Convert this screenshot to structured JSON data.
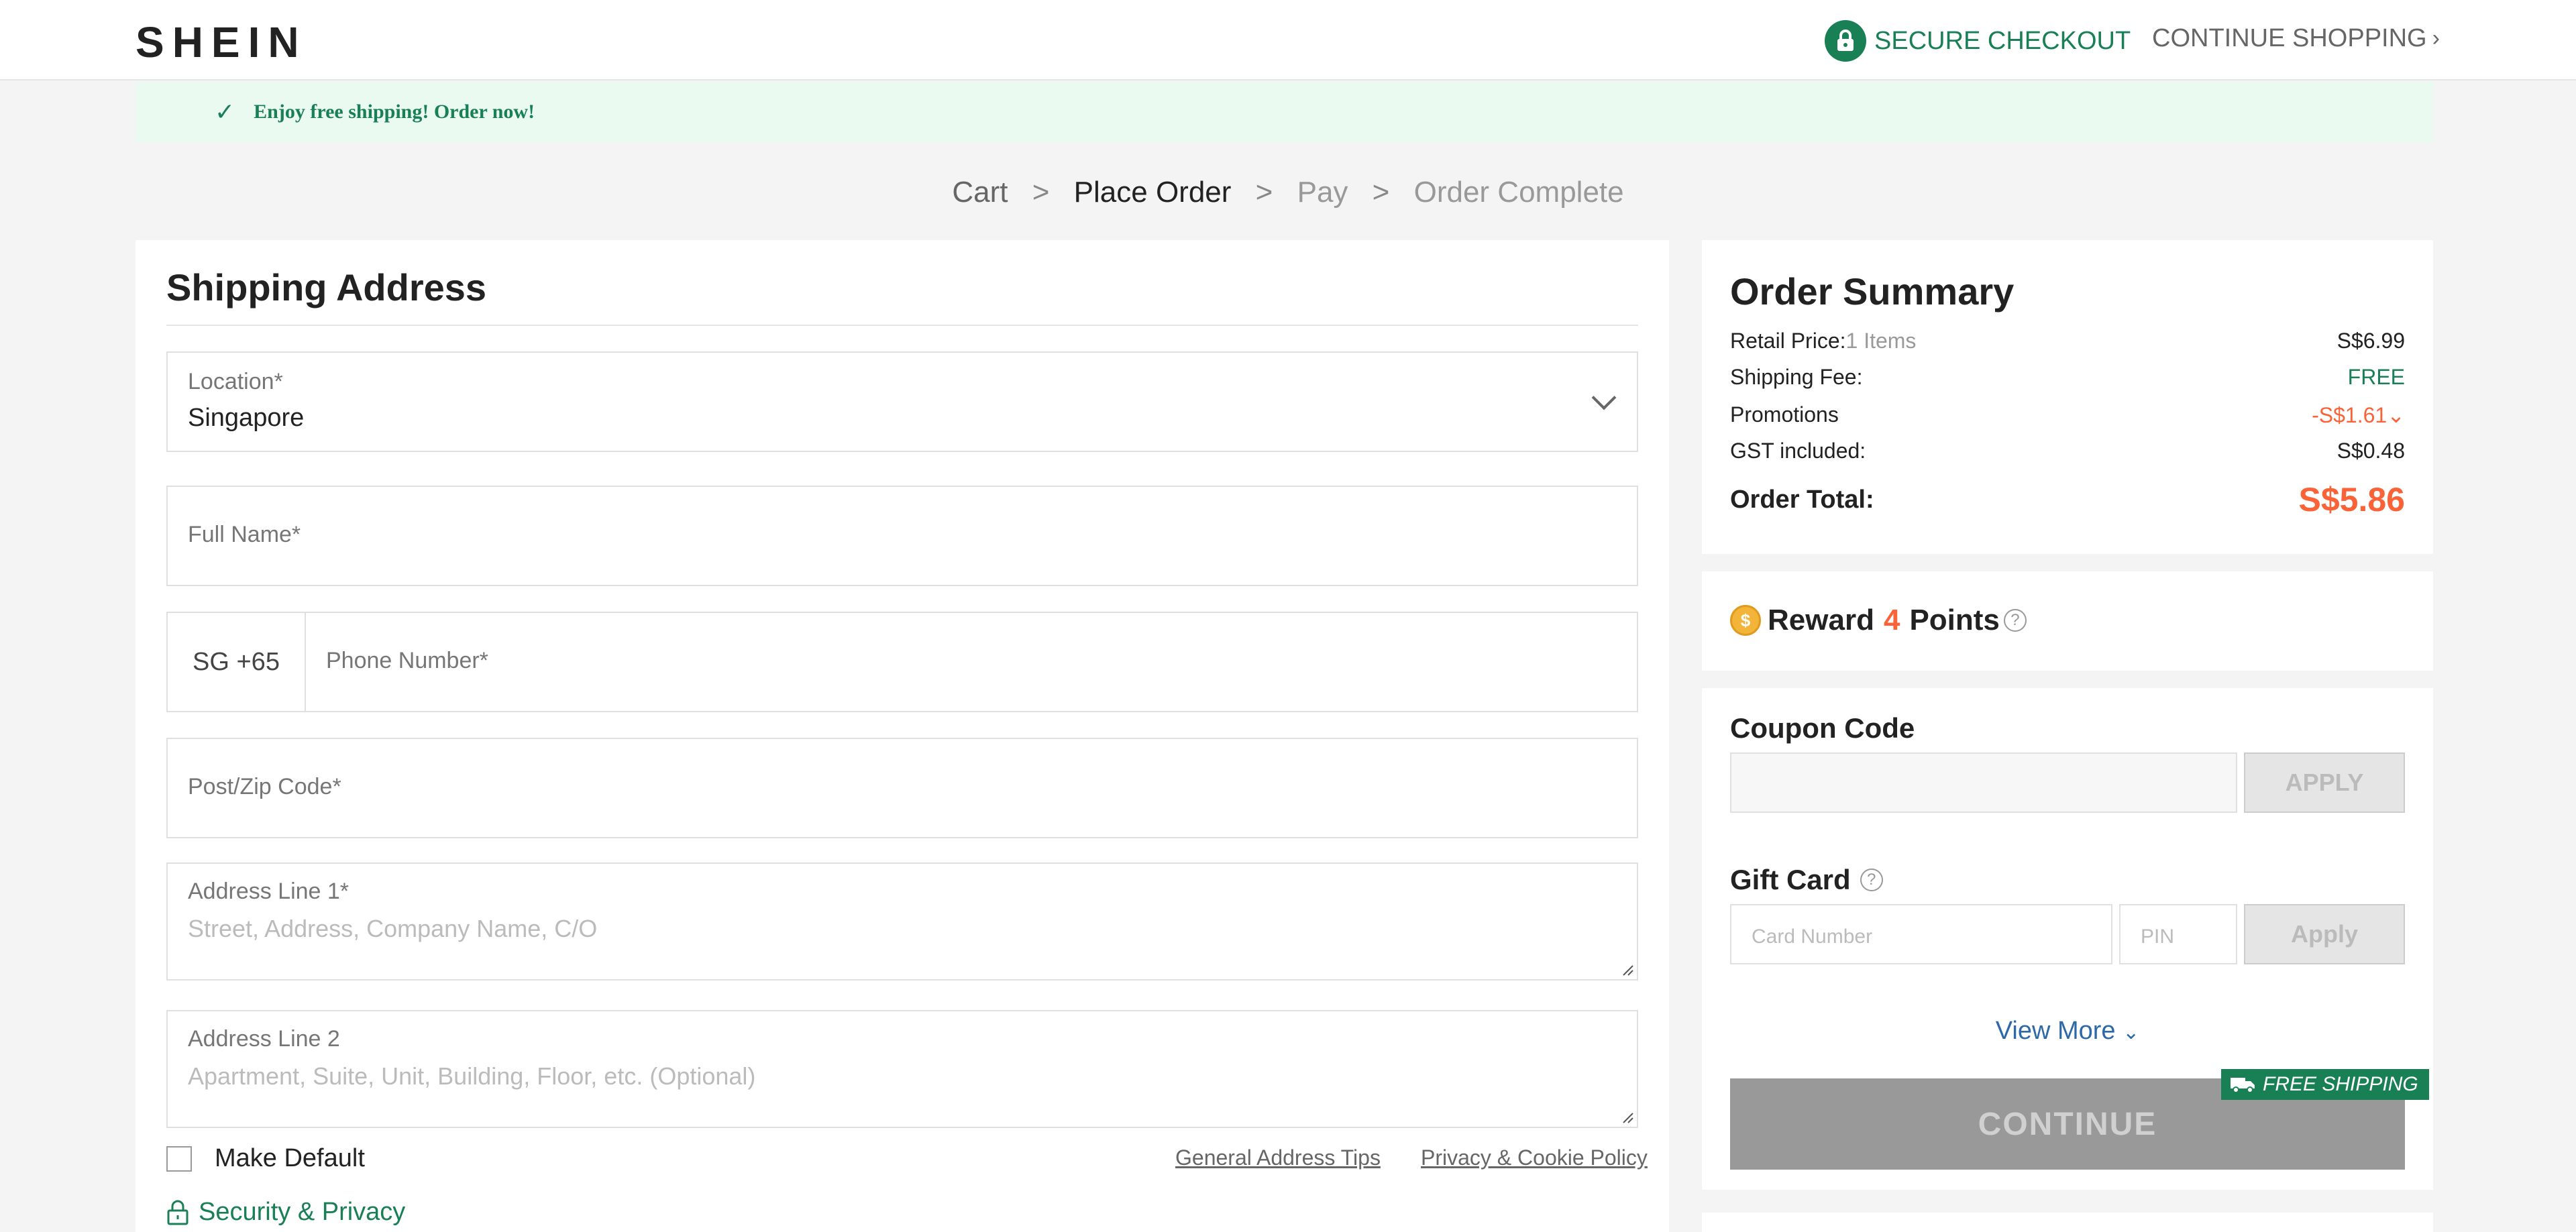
{
  "header": {
    "logo": "SHEIN",
    "secure_checkout": "SECURE CHECKOUT",
    "continue_shopping": "CONTINUE SHOPPING",
    "continue_chevron": "›"
  },
  "banner": {
    "check": "✓",
    "text": "Enjoy free shipping! Order now!"
  },
  "breadcrumb": {
    "separator": ">",
    "steps": [
      "Cart",
      "Place Order",
      "Pay",
      "Order Complete"
    ]
  },
  "shipping": {
    "title": "Shipping Address",
    "location_label": "Location*",
    "location_value": "Singapore",
    "full_name_label": "Full Name*",
    "phone_code": "SG +65",
    "phone_label": "Phone Number*",
    "postcode_label": "Post/Zip Code*",
    "address1_label": "Address Line 1*",
    "address1_placeholder": "Street, Address, Company Name, C/O",
    "address2_label": "Address Line 2",
    "address2_placeholder": "Apartment, Suite, Unit, Building, Floor, etc. (Optional)",
    "make_default": "Make Default",
    "address_tips": "General Address Tips",
    "privacy_policy": "Privacy & Cookie Policy",
    "security_privacy": "Security & Privacy"
  },
  "summary": {
    "title": "Order Summary",
    "retail_label": "Retail Price:",
    "retail_items": "1 Items",
    "retail_value": "S$6.99",
    "shipping_label": "Shipping Fee:",
    "shipping_value": "FREE",
    "promotions_label": "Promotions",
    "promotions_value": "-S$1.61",
    "promotions_caret": "⌄",
    "gst_label": "GST included:",
    "gst_value": "S$0.48",
    "total_label": "Order Total:",
    "total_value": "S$5.86"
  },
  "reward": {
    "prefix": "Reward",
    "points": "4",
    "suffix": "Points",
    "help": "?"
  },
  "coupon": {
    "title": "Coupon Code",
    "apply": "APPLY"
  },
  "giftcard": {
    "title": "Gift Card",
    "help": "?",
    "card_placeholder": "Card Number",
    "pin_placeholder": "PIN",
    "apply": "Apply"
  },
  "actions": {
    "view_more": "View More",
    "view_more_caret": "⌄",
    "continue": "CONTINUE",
    "free_shipping": "FREE SHIPPING"
  },
  "colors": {
    "brand_green": "#198055",
    "accent_red": "#fa6338",
    "link_blue": "#2d68a8"
  }
}
